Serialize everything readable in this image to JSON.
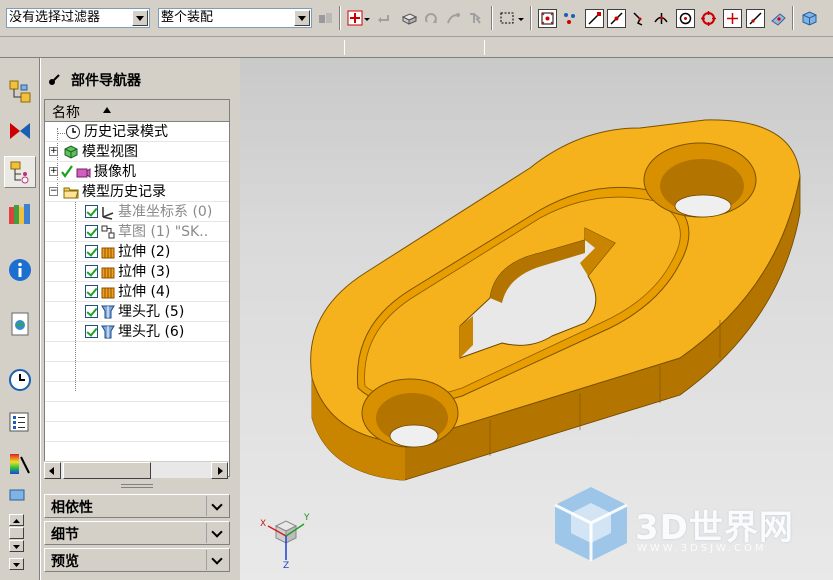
{
  "toolbar": {
    "filter_combo": "没有选择过滤器",
    "assembly_combo": "整个装配"
  },
  "navigator": {
    "title": "部件导航器",
    "column_name": "名称",
    "items": [
      {
        "label": "历史记录模式",
        "icon": "clock-icon"
      },
      {
        "label": "模型视图",
        "icon": "model-views-icon"
      },
      {
        "label": "摄像机",
        "icon": "camera-icon"
      },
      {
        "label": "模型历史记录",
        "icon": "folder-icon"
      },
      {
        "label": "基准坐标系 (0)",
        "icon": "datum-csys-icon"
      },
      {
        "label": "草图 (1) \"SK..",
        "icon": "sketch-icon"
      },
      {
        "label": "拉伸 (2)",
        "icon": "extrude-icon"
      },
      {
        "label": "拉伸 (3)",
        "icon": "extrude-icon"
      },
      {
        "label": "拉伸 (4)",
        "icon": "extrude-icon"
      },
      {
        "label": "埋头孔 (5)",
        "icon": "countersink-hole-icon"
      },
      {
        "label": "埋头孔 (6)",
        "icon": "countersink-hole-icon"
      }
    ]
  },
  "sections": {
    "dependencies": "相依性",
    "details": "细节",
    "preview": "预览"
  },
  "viewport": {
    "part_color": "#f5b21c",
    "watermark_text": "3D世界网",
    "watermark_url": "WWW.3DSJW.COM",
    "triad_x": "X",
    "triad_y": "Y",
    "triad_z": "Z"
  }
}
